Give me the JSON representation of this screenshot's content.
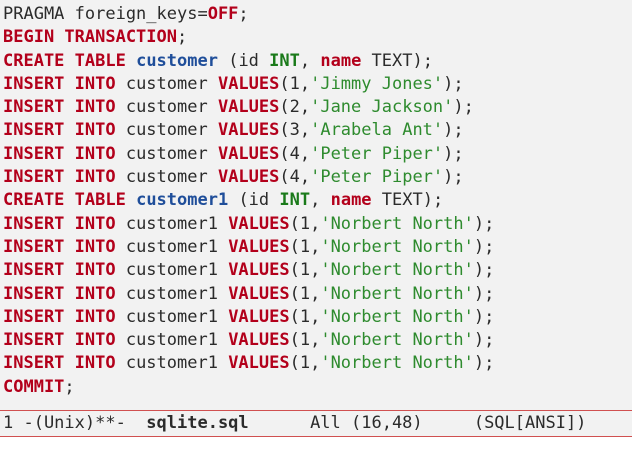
{
  "editor": {
    "lines": [
      [
        {
          "t": "PRAGMA foreign_keys=",
          "c": "txt"
        },
        {
          "t": "OFF",
          "c": "kw"
        },
        {
          "t": ";",
          "c": "txt"
        }
      ],
      [
        {
          "t": "BEGIN TRANSACTION",
          "c": "kw"
        },
        {
          "t": ";",
          "c": "txt"
        }
      ],
      [
        {
          "t": "CREATE TABLE",
          "c": "kw"
        },
        {
          "t": " ",
          "c": "txt"
        },
        {
          "t": "customer",
          "c": "tbl"
        },
        {
          "t": " (id ",
          "c": "txt"
        },
        {
          "t": "INT",
          "c": "type"
        },
        {
          "t": ", ",
          "c": "txt"
        },
        {
          "t": "name",
          "c": "kw"
        },
        {
          "t": " TEXT);",
          "c": "txt"
        }
      ],
      [
        {
          "t": "INSERT INTO",
          "c": "kw"
        },
        {
          "t": " customer ",
          "c": "txt"
        },
        {
          "t": "VALUES",
          "c": "kw"
        },
        {
          "t": "(1,",
          "c": "txt"
        },
        {
          "t": "'Jimmy Jones'",
          "c": "str"
        },
        {
          "t": ");",
          "c": "txt"
        }
      ],
      [
        {
          "t": "INSERT INTO",
          "c": "kw"
        },
        {
          "t": " customer ",
          "c": "txt"
        },
        {
          "t": "VALUES",
          "c": "kw"
        },
        {
          "t": "(2,",
          "c": "txt"
        },
        {
          "t": "'Jane Jackson'",
          "c": "str"
        },
        {
          "t": ");",
          "c": "txt"
        }
      ],
      [
        {
          "t": "INSERT INTO",
          "c": "kw"
        },
        {
          "t": " customer ",
          "c": "txt"
        },
        {
          "t": "VALUES",
          "c": "kw"
        },
        {
          "t": "(3,",
          "c": "txt"
        },
        {
          "t": "'Arabela Ant'",
          "c": "str"
        },
        {
          "t": ");",
          "c": "txt"
        }
      ],
      [
        {
          "t": "INSERT INTO",
          "c": "kw"
        },
        {
          "t": " customer ",
          "c": "txt"
        },
        {
          "t": "VALUES",
          "c": "kw"
        },
        {
          "t": "(4,",
          "c": "txt"
        },
        {
          "t": "'Peter Piper'",
          "c": "str"
        },
        {
          "t": ");",
          "c": "txt"
        }
      ],
      [
        {
          "t": "INSERT INTO",
          "c": "kw"
        },
        {
          "t": " customer ",
          "c": "txt"
        },
        {
          "t": "VALUES",
          "c": "kw"
        },
        {
          "t": "(4,",
          "c": "txt"
        },
        {
          "t": "'Peter Piper'",
          "c": "str"
        },
        {
          "t": ");",
          "c": "txt"
        }
      ],
      [
        {
          "t": "CREATE TABLE",
          "c": "kw"
        },
        {
          "t": " ",
          "c": "txt"
        },
        {
          "t": "customer1",
          "c": "tbl"
        },
        {
          "t": " (id ",
          "c": "txt"
        },
        {
          "t": "INT",
          "c": "type"
        },
        {
          "t": ", ",
          "c": "txt"
        },
        {
          "t": "name",
          "c": "kw"
        },
        {
          "t": " TEXT);",
          "c": "txt"
        }
      ],
      [
        {
          "t": "INSERT INTO",
          "c": "kw"
        },
        {
          "t": " customer1 ",
          "c": "txt"
        },
        {
          "t": "VALUES",
          "c": "kw"
        },
        {
          "t": "(1,",
          "c": "txt"
        },
        {
          "t": "'Norbert North'",
          "c": "str"
        },
        {
          "t": ");",
          "c": "txt"
        }
      ],
      [
        {
          "t": "INSERT INTO",
          "c": "kw"
        },
        {
          "t": " customer1 ",
          "c": "txt"
        },
        {
          "t": "VALUES",
          "c": "kw"
        },
        {
          "t": "(1,",
          "c": "txt"
        },
        {
          "t": "'Norbert North'",
          "c": "str"
        },
        {
          "t": ");",
          "c": "txt"
        }
      ],
      [
        {
          "t": "INSERT INTO",
          "c": "kw"
        },
        {
          "t": " customer1 ",
          "c": "txt"
        },
        {
          "t": "VALUES",
          "c": "kw"
        },
        {
          "t": "(1,",
          "c": "txt"
        },
        {
          "t": "'Norbert North'",
          "c": "str"
        },
        {
          "t": ");",
          "c": "txt"
        }
      ],
      [
        {
          "t": "INSERT INTO",
          "c": "kw"
        },
        {
          "t": " customer1 ",
          "c": "txt"
        },
        {
          "t": "VALUES",
          "c": "kw"
        },
        {
          "t": "(1,",
          "c": "txt"
        },
        {
          "t": "'Norbert North'",
          "c": "str"
        },
        {
          "t": ");",
          "c": "txt"
        }
      ],
      [
        {
          "t": "INSERT INTO",
          "c": "kw"
        },
        {
          "t": " customer1 ",
          "c": "txt"
        },
        {
          "t": "VALUES",
          "c": "kw"
        },
        {
          "t": "(1,",
          "c": "txt"
        },
        {
          "t": "'Norbert North'",
          "c": "str"
        },
        {
          "t": ");",
          "c": "txt"
        }
      ],
      [
        {
          "t": "INSERT INTO",
          "c": "kw"
        },
        {
          "t": " customer1 ",
          "c": "txt"
        },
        {
          "t": "VALUES",
          "c": "kw"
        },
        {
          "t": "(1,",
          "c": "txt"
        },
        {
          "t": "'Norbert North'",
          "c": "str"
        },
        {
          "t": ");",
          "c": "txt"
        }
      ],
      [
        {
          "t": "INSERT INTO",
          "c": "kw"
        },
        {
          "t": " customer1 ",
          "c": "txt"
        },
        {
          "t": "VALUES",
          "c": "kw"
        },
        {
          "t": "(1,",
          "c": "txt"
        },
        {
          "t": "'Norbert North'",
          "c": "str"
        },
        {
          "t": ");",
          "c": "txt"
        }
      ],
      [
        {
          "t": "COMMIT",
          "c": "kw"
        },
        {
          "t": ";",
          "c": "txt"
        }
      ]
    ]
  },
  "modeline": {
    "status": "1 -(Unix)**-  ",
    "buffer_name": "sqlite.sql",
    "position": "      All (16,48)     ",
    "mode": "(SQL[ANSI])"
  },
  "colors": {
    "keyword": "#b3001b",
    "table_name": "#1f4e9a",
    "type": "#1a7a1a",
    "string": "#2e8b2e",
    "text": "#2b2b2b",
    "background": "#f2f2f2",
    "modeline_border": "#d05050"
  }
}
